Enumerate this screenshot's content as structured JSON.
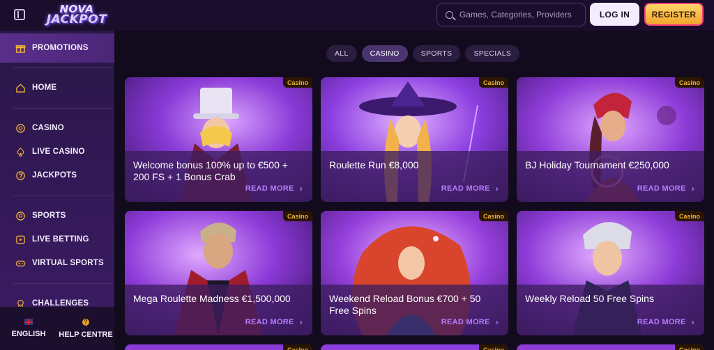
{
  "header": {
    "logo_line1": "NOVA",
    "logo_line2": "JACKPOT",
    "search_placeholder": "Games, Categories, Providers",
    "login_label": "LOG IN",
    "register_label": "REGISTER"
  },
  "sidebar": {
    "items": [
      {
        "label": "PROMOTIONS",
        "icon": "gift-icon"
      },
      {
        "label": "HOME",
        "icon": "home-icon"
      },
      {
        "label": "CASINO",
        "icon": "casino-chip-icon"
      },
      {
        "label": "LIVE CASINO",
        "icon": "spade-icon"
      },
      {
        "label": "JACKPOTS",
        "icon": "seven-icon"
      },
      {
        "label": "SPORTS",
        "icon": "ball-icon"
      },
      {
        "label": "LIVE BETTING",
        "icon": "play-icon"
      },
      {
        "label": "VIRTUAL SPORTS",
        "icon": "gamepad-icon"
      },
      {
        "label": "CHALLENGES",
        "icon": "medal-icon"
      }
    ],
    "footer": {
      "language_label": "ENGLISH",
      "help_label": "HELP CENTRE"
    }
  },
  "filters": [
    "ALL",
    "CASINO",
    "SPORTS",
    "SPECIALS"
  ],
  "active_filter": "CASINO",
  "cards": [
    {
      "tag": "Casino",
      "title": "Welcome bonus 100% up to €500 + 200 FS + 1 Bonus Crab",
      "cta": "READ MORE"
    },
    {
      "tag": "Casino",
      "title": "Roulette Run €8,000",
      "cta": "READ MORE"
    },
    {
      "tag": "Casino",
      "title": "BJ Holiday Tournament €250,000",
      "cta": "READ MORE"
    },
    {
      "tag": "Casino",
      "title": "Mega Roulette Madness €1,500,000",
      "cta": "READ MORE"
    },
    {
      "tag": "Casino",
      "title": "Weekend Reload Bonus €700 + 50 Free Spins",
      "cta": "READ MORE"
    },
    {
      "tag": "Casino",
      "title": "Weekly Reload 50 Free Spins",
      "cta": "READ MORE"
    },
    {
      "tag": "Casino"
    },
    {
      "tag": "Casino"
    },
    {
      "tag": "Casino"
    }
  ],
  "colors": {
    "accent": "#b77cff",
    "brand_gold": "#f2a52f",
    "sidebar_bg": "#2a1747",
    "main_bg": "#120b1d"
  }
}
